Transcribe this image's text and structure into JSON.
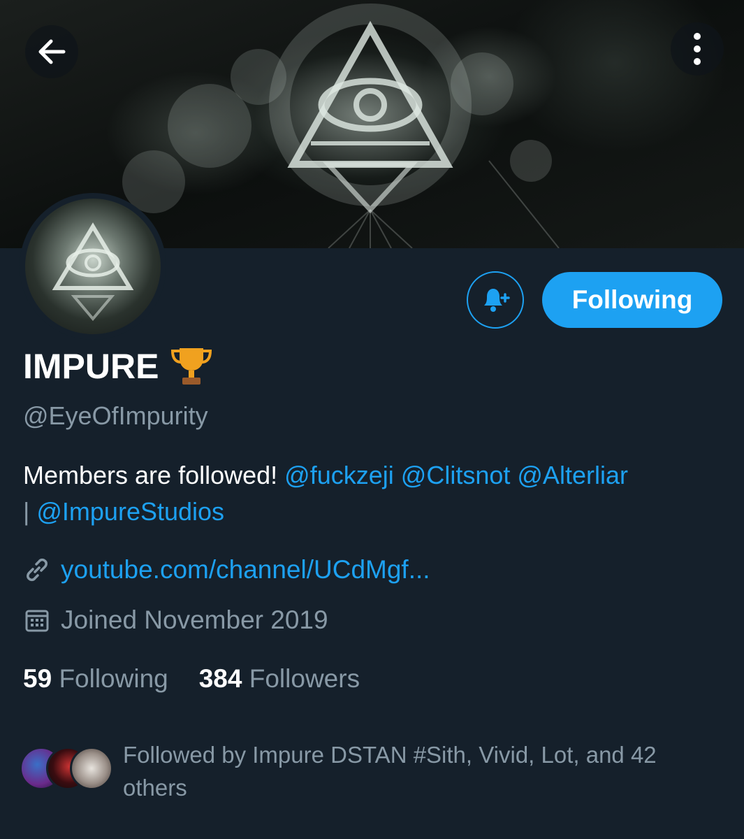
{
  "header": {
    "back_icon": "arrow-left-icon",
    "more_icon": "more-vertical-icon"
  },
  "profile": {
    "name": "IMPURE",
    "badge_emoji": "🏆",
    "handle": "@EyeOfImpurity",
    "bio_text": "Members are followed!",
    "bio_mentions": [
      "@fuckzeji",
      "@Clitsnot",
      "@Alterliar"
    ],
    "bio_separator": "|",
    "bio_last_mention": "@ImpureStudios",
    "website": "youtube.com/channel/UCdMgf...",
    "joined": "Joined November 2019"
  },
  "actions": {
    "notify_icon": "bell-plus-icon",
    "follow_label": "Following"
  },
  "stats": {
    "following_count": "59",
    "following_label": "Following",
    "followers_count": "384",
    "followers_label": "Followers"
  },
  "followed_by": {
    "text": "Followed by Impure DSTAN #Sith, Vivid, Lot, and 42 others"
  },
  "colors": {
    "background": "#15202b",
    "accent": "#1da1f2",
    "secondary_text": "#8899a6"
  }
}
